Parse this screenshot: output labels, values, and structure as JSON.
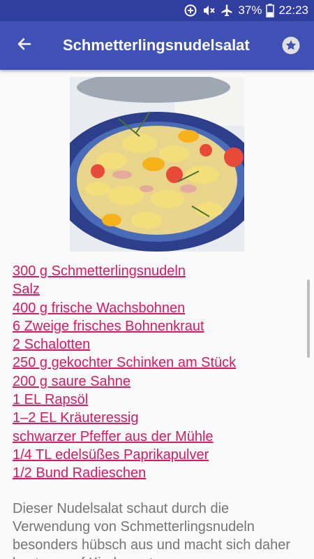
{
  "status_bar": {
    "battery_percent": "37%",
    "time": "22:23",
    "icons": [
      "data-saver-icon",
      "mute-icon",
      "airplane-mode-icon",
      "battery-icon"
    ]
  },
  "app_bar": {
    "title": "Schmetterlingsnudelsalat",
    "back_icon": "arrow-left-icon",
    "favorite_icon": "star-icon"
  },
  "recipe": {
    "image_alt": "pasta salad photo",
    "ingredients": [
      "300 g Schmetterlingsnudeln",
      "Salz",
      "400 g frische Wachsbohnen",
      "6 Zweige frisches Bohnenkraut",
      "2 Schalotten",
      "250 g gekochter Schinken am Stück",
      "200 g saure Sahne",
      "1 EL Rapsöl",
      "1–2 EL Kräuteressig",
      "schwarzer Pfeffer aus der Mühle",
      "1/4 TL edelsüßes Paprikapulver",
      "1/2 Bund Radieschen"
    ],
    "description": "Dieser Nudelsalat schaut durch die Verwendung von Schmetterlingsnudeln besonders hübsch aus und macht sich daher bestens auf Kinderpartys"
  },
  "colors": {
    "status_bar": "#303f9f",
    "app_bar": "#3f51b5",
    "link": "#d81b60",
    "body_text": "#757575"
  }
}
